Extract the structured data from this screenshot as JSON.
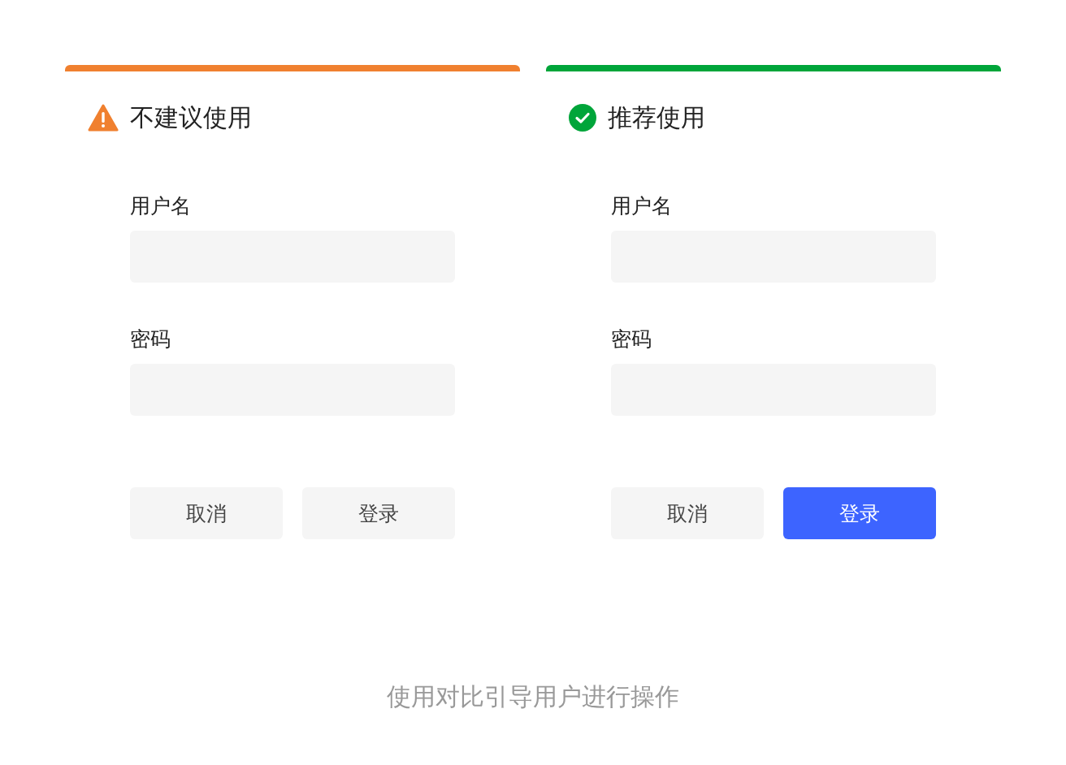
{
  "cards": [
    {
      "kind": "warning",
      "color": "#f0802f",
      "title": "不建议使用",
      "fields": [
        {
          "label": "用户名"
        },
        {
          "label": "密码"
        }
      ],
      "buttons": [
        {
          "label": "取消",
          "primary": false
        },
        {
          "label": "登录",
          "primary": false
        }
      ]
    },
    {
      "kind": "success",
      "color": "#00a53a",
      "title": "推荐使用",
      "fields": [
        {
          "label": "用户名"
        },
        {
          "label": "密码"
        }
      ],
      "buttons": [
        {
          "label": "取消",
          "primary": false
        },
        {
          "label": "登录",
          "primary": true
        }
      ]
    }
  ],
  "caption": "使用对比引导用户进行操作"
}
